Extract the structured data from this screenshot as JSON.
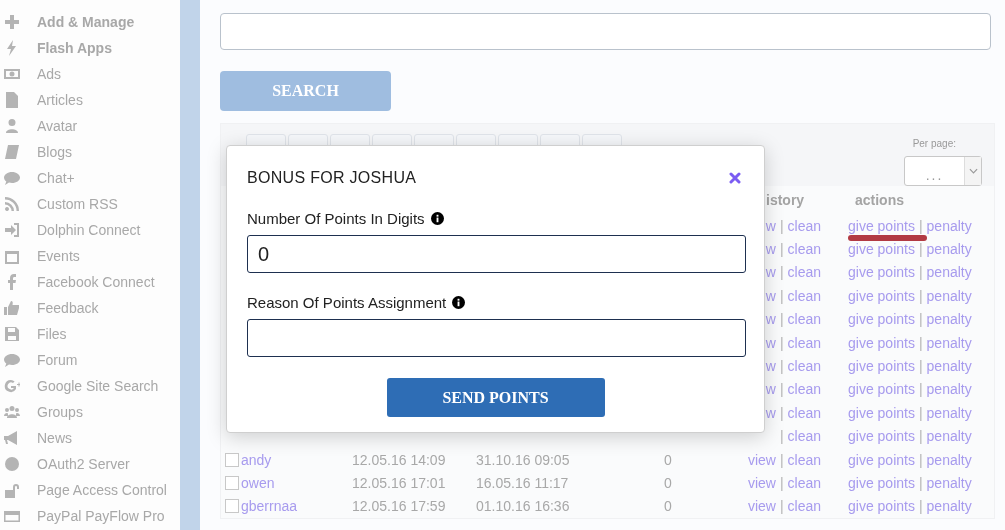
{
  "sidebar": {
    "items": [
      {
        "label": "Add & Manage",
        "kind": "group"
      },
      {
        "label": "Flash Apps",
        "kind": "group"
      },
      {
        "label": "Ads",
        "kind": "module"
      },
      {
        "label": "Articles",
        "kind": "module"
      },
      {
        "label": "Avatar",
        "kind": "module"
      },
      {
        "label": "Blogs",
        "kind": "module"
      },
      {
        "label": "Chat+",
        "kind": "module"
      },
      {
        "label": "Custom RSS",
        "kind": "module"
      },
      {
        "label": "Dolphin Connect",
        "kind": "module"
      },
      {
        "label": "Events",
        "kind": "module"
      },
      {
        "label": "Facebook Connect",
        "kind": "module"
      },
      {
        "label": "Feedback",
        "kind": "module"
      },
      {
        "label": "Files",
        "kind": "module"
      },
      {
        "label": "Forum",
        "kind": "module"
      },
      {
        "label": "Google Site Search",
        "kind": "module"
      },
      {
        "label": "Groups",
        "kind": "module"
      },
      {
        "label": "News",
        "kind": "module"
      },
      {
        "label": "OAuth2 Server",
        "kind": "module"
      },
      {
        "label": "Page Access Control",
        "kind": "module"
      },
      {
        "label": "PayPal PayFlow Pro",
        "kind": "module"
      }
    ]
  },
  "search_button": "SEARCH",
  "per_page": {
    "label": "Per page:",
    "value": "..."
  },
  "table": {
    "columns": [
      "istory",
      "actions"
    ],
    "rows": [
      {
        "history": [
          "w",
          "|",
          "clean"
        ],
        "actions": [
          "give points",
          "|",
          "penalty"
        ],
        "underlined": true
      },
      {
        "history": [
          "w",
          "|",
          "clean"
        ],
        "actions": [
          "give points",
          "|",
          "penalty"
        ],
        "underlined": false
      },
      {
        "history": [
          "w",
          "|",
          "clean"
        ],
        "actions": [
          "give points",
          "|",
          "penalty"
        ],
        "underlined": false
      },
      {
        "history": [
          "w",
          "|",
          "clean"
        ],
        "actions": [
          "give points",
          "|",
          "penalty"
        ],
        "underlined": false
      },
      {
        "history": [
          "w",
          "|",
          "clean"
        ],
        "actions": [
          "give points",
          "|",
          "penalty"
        ],
        "underlined": false
      },
      {
        "history": [
          "w",
          "|",
          "clean"
        ],
        "actions": [
          "give points",
          "|",
          "penalty"
        ],
        "underlined": false
      },
      {
        "history": [
          "w",
          "|",
          "clean"
        ],
        "actions": [
          "give points",
          "|",
          "penalty"
        ],
        "underlined": false
      },
      {
        "history": [
          "w",
          "|",
          "clean"
        ],
        "actions": [
          "give points",
          "|",
          "penalty"
        ],
        "underlined": false
      },
      {
        "history": [
          "w",
          "|",
          "clean"
        ],
        "actions": [
          "give points",
          "|",
          "penalty"
        ],
        "underlined": false
      },
      {
        "history": [
          "|",
          "clean"
        ],
        "actions": [
          "give points",
          "|",
          "penalty"
        ],
        "underlined": false
      },
      {
        "checked": false,
        "user": "andy",
        "joined": "12.05.16 14:09",
        "last": "31.10.16 09:05",
        "points": "0",
        "history": [
          "view",
          "|",
          "clean"
        ],
        "actions": [
          "give points",
          "|",
          "penalty"
        ],
        "underlined": false
      },
      {
        "checked": false,
        "user": "owen",
        "joined": "12.05.16 17:01",
        "last": "16.05.16 11:17",
        "points": "0",
        "history": [
          "view",
          "|",
          "clean"
        ],
        "actions": [
          "give points",
          "|",
          "penalty"
        ],
        "underlined": false
      },
      {
        "checked": false,
        "user": "gberrnaa",
        "joined": "12.05.16 17:59",
        "last": "01.10.16 16:36",
        "points": "0",
        "history": [
          "view",
          "|",
          "clean"
        ],
        "actions": [
          "give points",
          "|",
          "penalty"
        ],
        "underlined": false
      }
    ]
  },
  "modal": {
    "title": "BONUS FOR JOSHUA",
    "fields": [
      {
        "label": "Number Of Points In Digits",
        "value": "0"
      },
      {
        "label": "Reason Of Points Assignment"
      }
    ],
    "button": "SEND POINTS"
  }
}
